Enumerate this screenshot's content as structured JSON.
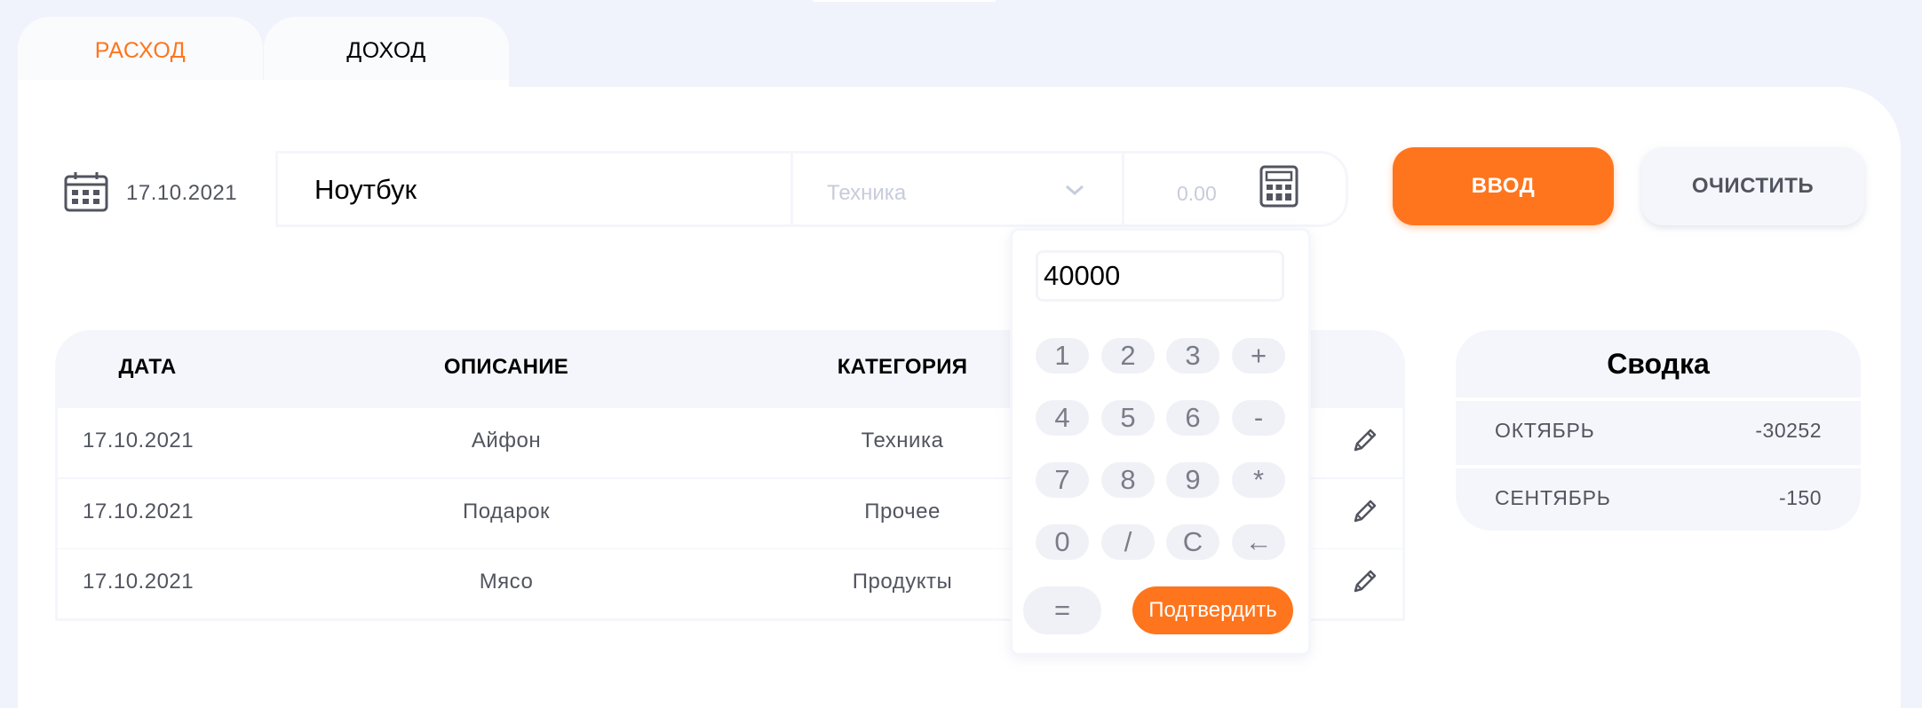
{
  "tabs": {
    "expense_label": "Расход",
    "income_label": "Доход",
    "active": "expense"
  },
  "form": {
    "date": "17.10.2021",
    "description_value": "Ноутбук",
    "category_placeholder": "Техника",
    "amount_placeholder": "0.00",
    "enter_label": "Ввод",
    "clear_label": "Очистить"
  },
  "calculator": {
    "display_value": "40000",
    "keys": [
      "1",
      "2",
      "3",
      "+",
      "4",
      "5",
      "6",
      "-",
      "7",
      "8",
      "9",
      "*",
      "0",
      "/",
      "C",
      "←"
    ],
    "equals_label": "=",
    "confirm_label": "Подтвердить"
  },
  "table": {
    "headers": {
      "date": "Дата",
      "description": "Описание",
      "category": "Категория"
    },
    "rows": [
      {
        "date": "17.10.2021",
        "description": "Айфон",
        "category": "Техника"
      },
      {
        "date": "17.10.2021",
        "description": "Подарок",
        "category": "Прочее"
      },
      {
        "date": "17.10.2021",
        "description": "Мясо",
        "category": "Продукты"
      }
    ]
  },
  "summary": {
    "title": "Сводка",
    "items": [
      {
        "month": "Октябрь",
        "value": "-30252"
      },
      {
        "month": "Сентябрь",
        "value": "-150"
      }
    ]
  },
  "colors": {
    "accent": "#ff751d",
    "text_muted": "#52555f",
    "background": "#f0f3fb",
    "panel": "#ffffff",
    "light_gray": "#f5f6fb"
  }
}
